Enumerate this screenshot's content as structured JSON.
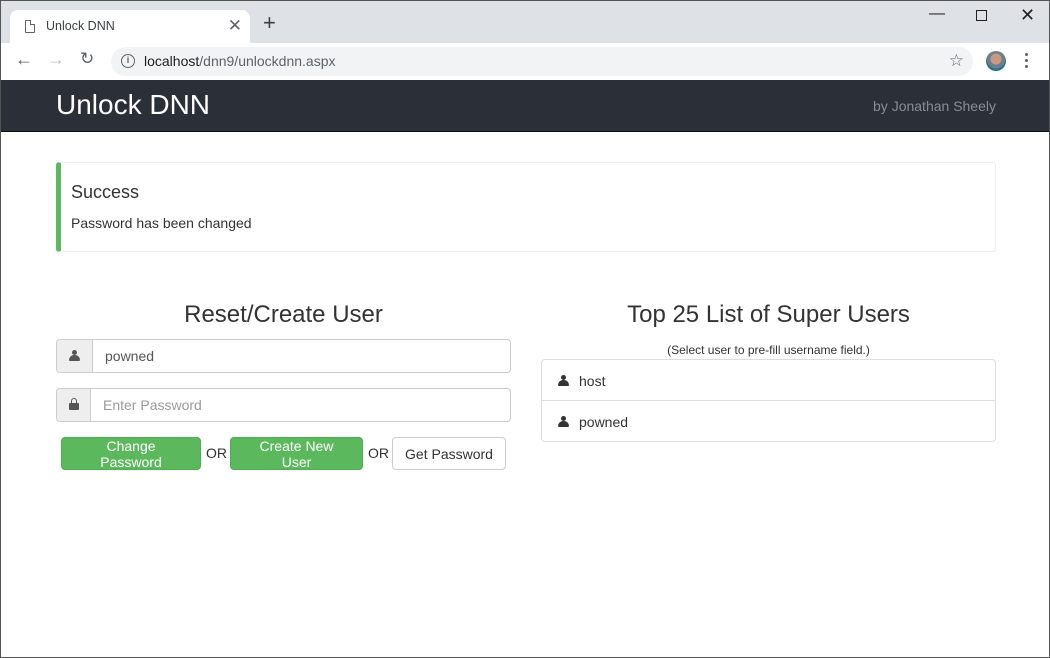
{
  "browser": {
    "tab_title": "Unlock DNN",
    "url_host": "localhost",
    "url_path": "/dnn9/unlockdnn.aspx",
    "new_tab_glyph": "+",
    "tab_close_glyph": "✕",
    "back_glyph": "←",
    "forward_glyph": "→",
    "reload_glyph": "↻",
    "info_glyph": "i",
    "star_glyph": "☆",
    "minimize_glyph": "—",
    "close_glyph": "✕"
  },
  "navbar": {
    "brand": "Unlock DNN",
    "byline": "by Jonathan Sheely"
  },
  "alert": {
    "title": "Success",
    "message": "Password has been changed",
    "accent_color": "#5cb85c"
  },
  "reset_form": {
    "title": "Reset/Create User",
    "username_value": "powned",
    "password_value": "",
    "password_placeholder": "Enter Password",
    "change_password_label": "Change Password",
    "or_label": "OR",
    "create_user_label": "Create New User",
    "get_password_label": "Get Password"
  },
  "super_users": {
    "title": "Top 25 List of Super Users",
    "hint": "(Select user to pre-fill username field.)",
    "items": [
      {
        "name": "host",
        "icon": "user-icon"
      },
      {
        "name": "powned",
        "icon": "user-icon"
      }
    ]
  }
}
